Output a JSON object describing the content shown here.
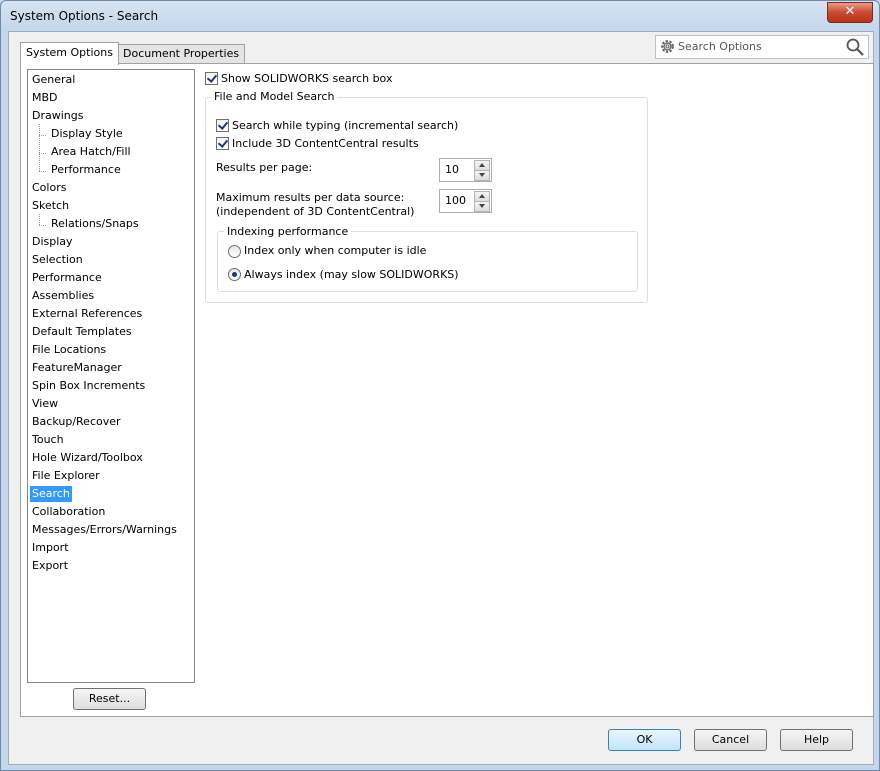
{
  "window": {
    "title": "System Options - Search",
    "close_glyph": "✕"
  },
  "tabs": [
    {
      "label": "System Options",
      "active": true
    },
    {
      "label": "Document Properties",
      "active": false
    }
  ],
  "search": {
    "placeholder": "Search Options",
    "icon_left": "gear-icon",
    "icon_right": "magnifier-icon"
  },
  "tree": {
    "items": [
      {
        "label": "General",
        "level": 0
      },
      {
        "label": "MBD",
        "level": 0
      },
      {
        "label": "Drawings",
        "level": 0
      },
      {
        "label": "Display Style",
        "level": 1
      },
      {
        "label": "Area Hatch/Fill",
        "level": 1
      },
      {
        "label": "Performance",
        "level": 1
      },
      {
        "label": "Colors",
        "level": 0
      },
      {
        "label": "Sketch",
        "level": 0
      },
      {
        "label": "Relations/Snaps",
        "level": 1
      },
      {
        "label": "Display",
        "level": 0
      },
      {
        "label": "Selection",
        "level": 0
      },
      {
        "label": "Performance",
        "level": 0
      },
      {
        "label": "Assemblies",
        "level": 0
      },
      {
        "label": "External References",
        "level": 0
      },
      {
        "label": "Default Templates",
        "level": 0
      },
      {
        "label": "File Locations",
        "level": 0
      },
      {
        "label": "FeatureManager",
        "level": 0
      },
      {
        "label": "Spin Box Increments",
        "level": 0
      },
      {
        "label": "View",
        "level": 0
      },
      {
        "label": "Backup/Recover",
        "level": 0
      },
      {
        "label": "Touch",
        "level": 0
      },
      {
        "label": "Hole Wizard/Toolbox",
        "level": 0
      },
      {
        "label": "File Explorer",
        "level": 0
      },
      {
        "label": "Search",
        "level": 0,
        "selected": true
      },
      {
        "label": "Collaboration",
        "level": 0
      },
      {
        "label": "Messages/Errors/Warnings",
        "level": 0
      },
      {
        "label": "Import",
        "level": 0
      },
      {
        "label": "Export",
        "level": 0
      }
    ]
  },
  "settings": {
    "show_search_box": {
      "label": "Show SOLIDWORKS search box",
      "checked": true
    },
    "file_model_group": {
      "title": "File and Model Search",
      "search_while_typing": {
        "label": "Search while typing (incremental search)",
        "checked": true
      },
      "include_3dcc": {
        "label": "Include 3D ContentCentral results",
        "checked": true
      },
      "results_per_page": {
        "label": "Results per page:",
        "value": "10"
      },
      "max_results_line1": "Maximum results per data source:",
      "max_results_line2": "(independent of 3D ContentCentral)",
      "max_results_value": "100",
      "indexing": {
        "title": "Indexing performance",
        "idle": {
          "label": "Index only when computer is idle",
          "selected": false
        },
        "always": {
          "label": "Always index (may slow SOLIDWORKS)",
          "selected": true
        }
      }
    }
  },
  "buttons": {
    "reset": "Reset...",
    "ok": "OK",
    "cancel": "Cancel",
    "help": "Help"
  },
  "colors": {
    "selection": "#3399ff",
    "title_bar": "#c3d6ea",
    "close_button": "#c94a30"
  }
}
